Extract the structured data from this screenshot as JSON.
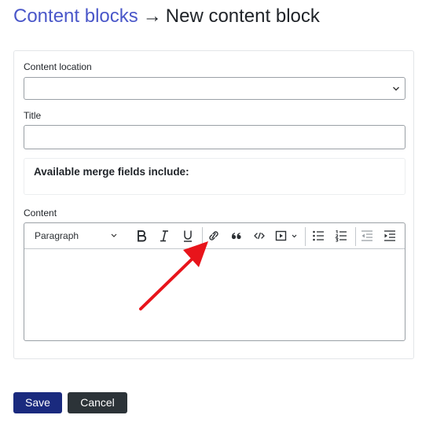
{
  "header": {
    "breadcrumb_link": "Content blocks",
    "arrow": "→",
    "current": "New content block"
  },
  "form": {
    "content_location_label": "Content location",
    "content_location_value": "",
    "title_label": "Title",
    "title_value": "",
    "merge_fields_title": "Available merge fields include:",
    "content_label": "Content"
  },
  "toolbar": {
    "paragraph_style": "Paragraph",
    "icons": [
      "chevron-down-icon",
      "bold-icon",
      "italic-icon",
      "underline-icon",
      "link-icon",
      "blockquote-icon",
      "code-icon",
      "media-embed-icon",
      "bulleted-list-icon",
      "numbered-list-icon",
      "outdent-icon",
      "indent-icon"
    ]
  },
  "actions": {
    "save_label": "Save",
    "cancel_label": "Cancel"
  },
  "colors": {
    "breadcrumb_link": "#4a57c9",
    "save_button": "#1a2a7e",
    "cancel_button": "#2c3338",
    "annotation_arrow": "#e8141b"
  }
}
